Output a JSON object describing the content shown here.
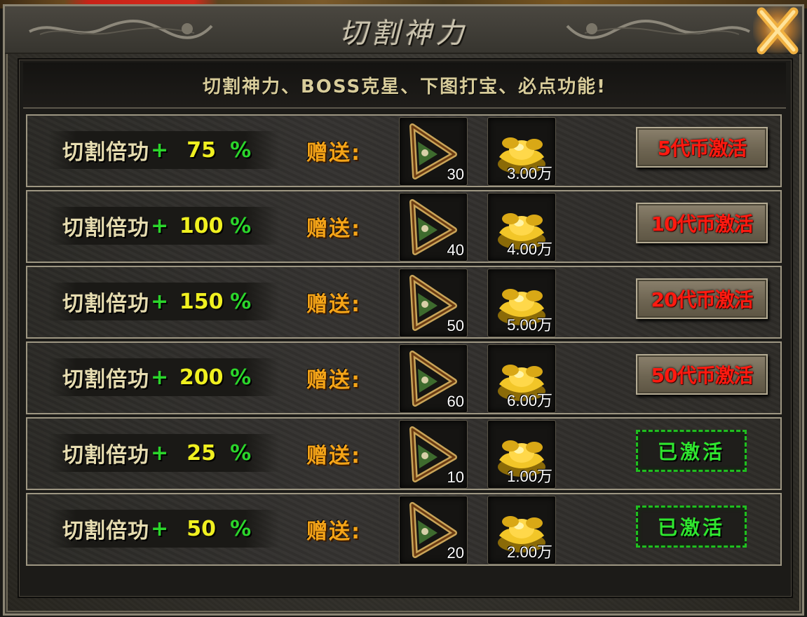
{
  "window": {
    "title": "切割神力"
  },
  "banner": "切割神力、BOSS克星、下图打宝、必点功能!",
  "labels": {
    "stat": "切割倍功",
    "plus": "+",
    "percent": "%",
    "gift": "赠送:"
  },
  "rows": [
    {
      "value": "75",
      "item_count": "30",
      "gold": "3.00万",
      "button": "5代币激活",
      "activated": false
    },
    {
      "value": "100",
      "item_count": "40",
      "gold": "4.00万",
      "button": "10代币激活",
      "activated": false
    },
    {
      "value": "150",
      "item_count": "50",
      "gold": "5.00万",
      "button": "20代币激活",
      "activated": false
    },
    {
      "value": "200",
      "item_count": "60",
      "gold": "6.00万",
      "button": "50代币激活",
      "activated": false
    },
    {
      "value": "25",
      "item_count": "10",
      "gold": "1.00万",
      "button": "已激活",
      "activated": true
    },
    {
      "value": "50",
      "item_count": "20",
      "gold": "2.00万",
      "button": "已激活",
      "activated": true
    }
  ],
  "icons": {
    "close": "close-x-icon",
    "item": "triangle-blade-icon",
    "gold": "gold-ingot-icon",
    "ornament": "dragon-ornament-icon"
  },
  "colors": {
    "value": "#f0f020",
    "plus_percent": "#2bd62b",
    "gift": "#f4a418",
    "buy_text": "#ff1a10",
    "activated": "#2fe62f"
  }
}
